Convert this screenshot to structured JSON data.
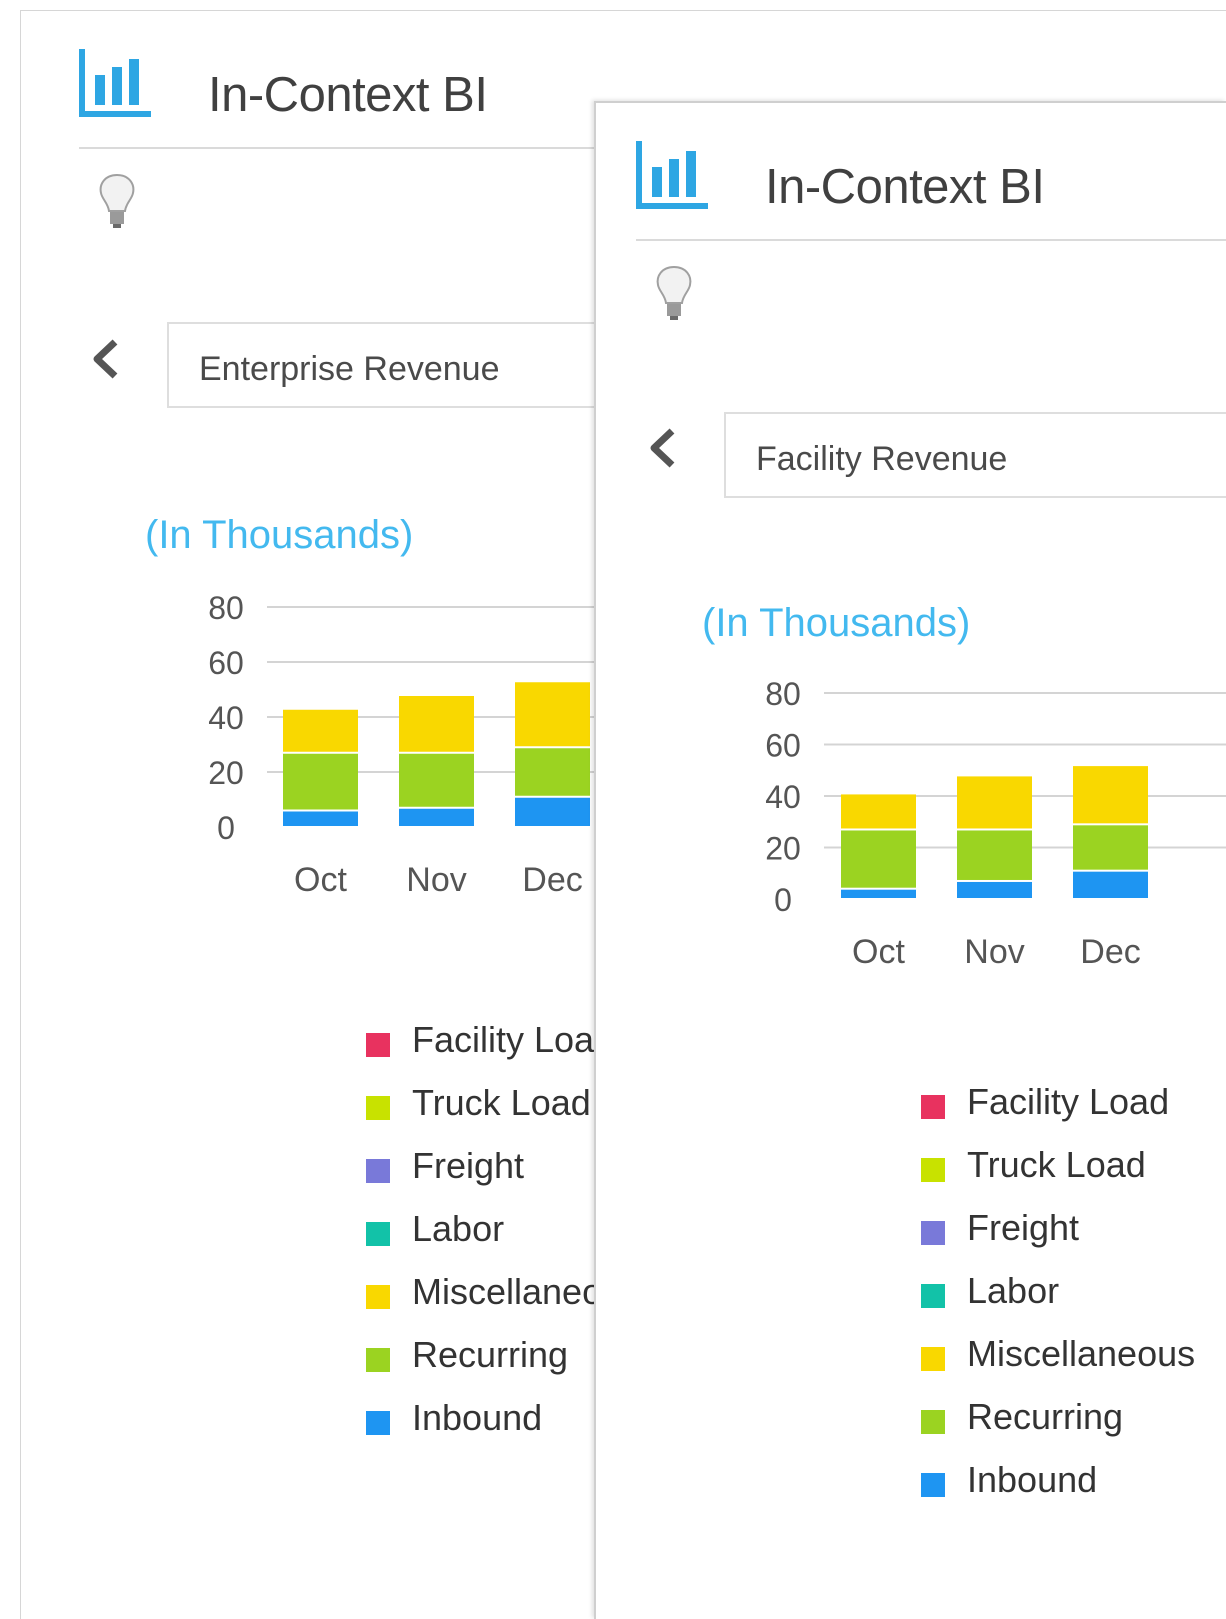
{
  "widgets": [
    {
      "title": "In-Context BI",
      "report": "Enterprise Revenue",
      "units": "(In Thousands)",
      "collapse_icon": "chevron-down-icon"
    },
    {
      "title": "In-Context BI",
      "report": "Facility Revenue",
      "units": "(In Thousands)"
    }
  ],
  "chart_data": [
    {
      "type": "bar",
      "stacked": true,
      "categories": [
        "Oct",
        "Nov",
        "Dec"
      ],
      "y_ticks": [
        80,
        60,
        40,
        20,
        0
      ],
      "ylim": [
        0,
        80
      ],
      "series": [
        {
          "name": "Inbound",
          "color": "#1e95f2",
          "values": [
            6,
            7,
            11
          ]
        },
        {
          "name": "Recurring",
          "color": "#9bd321",
          "values": [
            21,
            20,
            18
          ]
        },
        {
          "name": "Miscellaneous",
          "color": "#f9d800",
          "values": [
            16,
            21,
            24
          ]
        }
      ],
      "legend": [
        {
          "label": "Facility Load",
          "color": "#e8325f"
        },
        {
          "label": "Truck Load",
          "color": "#c8e200"
        },
        {
          "label": "Freight",
          "color": "#7979d9"
        },
        {
          "label": "Labor",
          "color": "#12c2a8"
        },
        {
          "label": "Miscellaneous",
          "color": "#f9d800"
        },
        {
          "label": "Recurring",
          "color": "#9bd321"
        },
        {
          "label": "Inbound",
          "color": "#1e95f2"
        }
      ]
    },
    {
      "type": "bar",
      "stacked": true,
      "categories": [
        "Oct",
        "Nov",
        "Dec"
      ],
      "y_ticks": [
        80,
        60,
        40,
        20,
        0
      ],
      "ylim": [
        0,
        80
      ],
      "series": [
        {
          "name": "Inbound",
          "color": "#1e95f2",
          "values": [
            4,
            7,
            11
          ]
        },
        {
          "name": "Recurring",
          "color": "#9bd321",
          "values": [
            23,
            20,
            18
          ]
        },
        {
          "name": "Miscellaneous",
          "color": "#f9d800",
          "values": [
            14,
            21,
            23
          ]
        }
      ],
      "legend": [
        {
          "label": "Facility Load",
          "color": "#e8325f"
        },
        {
          "label": "Truck Load",
          "color": "#c8e200"
        },
        {
          "label": "Freight",
          "color": "#7979d9"
        },
        {
          "label": "Labor",
          "color": "#12c2a8"
        },
        {
          "label": "Miscellaneous",
          "color": "#f9d800"
        },
        {
          "label": "Recurring",
          "color": "#9bd321"
        },
        {
          "label": "Inbound",
          "color": "#1e95f2"
        }
      ]
    }
  ]
}
